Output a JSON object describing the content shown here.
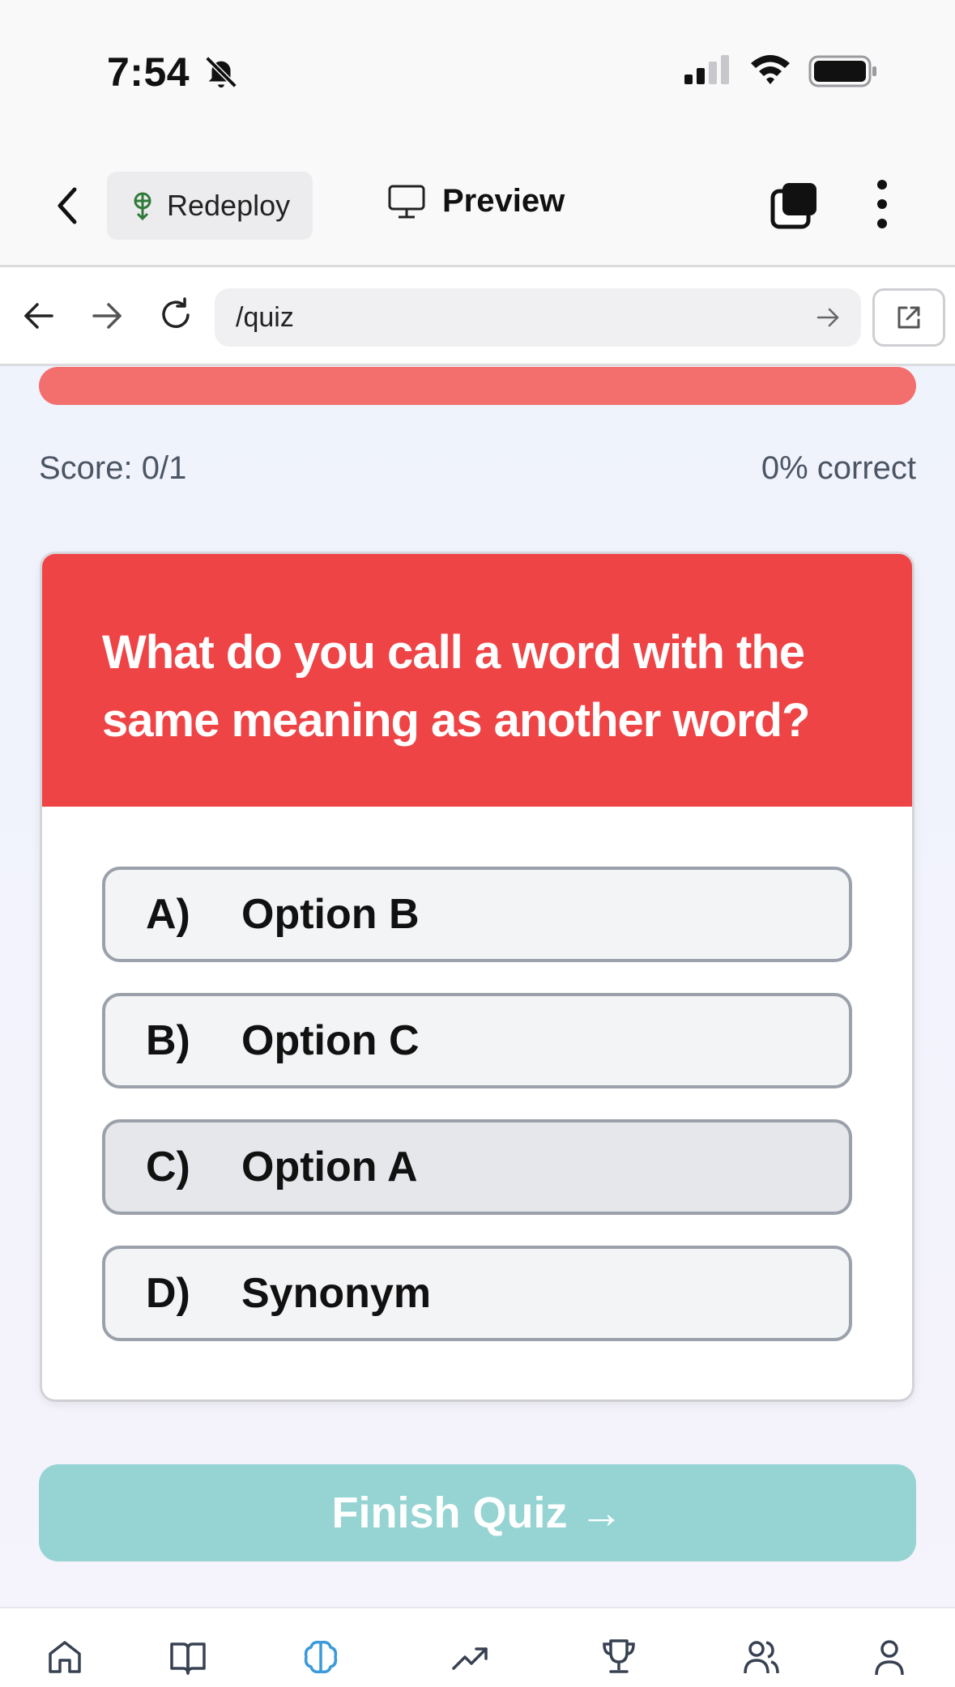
{
  "status_bar": {
    "time": "7:54"
  },
  "toolbar": {
    "redeploy_label": "Redeploy",
    "preview_label": "Preview"
  },
  "browser": {
    "url": "/quiz"
  },
  "quiz": {
    "score": "Score: 0/1",
    "percent": "0% correct",
    "progress": 1.0,
    "question": "What do you call a word with the same meaning as another word?",
    "options": [
      {
        "letter": "A)",
        "text": "Option B"
      },
      {
        "letter": "B)",
        "text": "Option C"
      },
      {
        "letter": "C)",
        "text": "Option A"
      },
      {
        "letter": "D)",
        "text": "Synonym"
      }
    ],
    "selected_option": "C)",
    "finish_label": "Finish Quiz →"
  },
  "bottom_nav": {
    "items": [
      "home-icon",
      "book-icon",
      "brain-icon",
      "trending-icon",
      "trophy-icon",
      "users-icon",
      "user-icon"
    ],
    "active": "brain-icon"
  },
  "colors": {
    "accent_red": "#ef4446",
    "progress": "#f26f6d",
    "finish": "#96d4d3",
    "active_nav": "#3b9ad9"
  }
}
